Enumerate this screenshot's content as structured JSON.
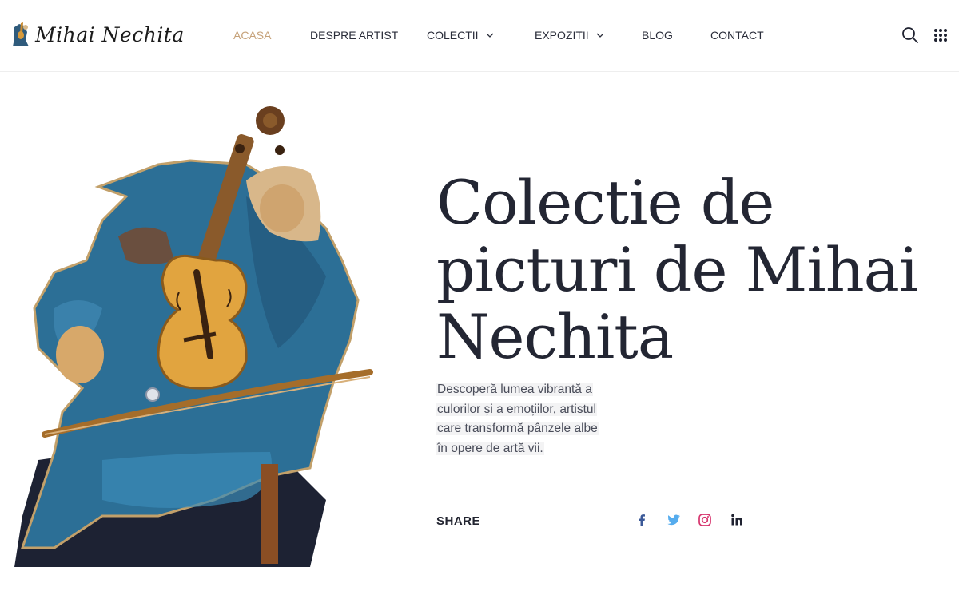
{
  "logo": {
    "text": "Mihai Nechita",
    "icon": "violinist-logo-icon"
  },
  "nav": [
    {
      "label": "ACASA",
      "active": true,
      "dropdown": false
    },
    {
      "label": "DESPRE ARTIST",
      "active": false,
      "dropdown": false
    },
    {
      "label": "COLECTII",
      "active": false,
      "dropdown": true
    },
    {
      "label": "EXPOZITII",
      "active": false,
      "dropdown": true
    },
    {
      "label": "BLOG",
      "active": false,
      "dropdown": false
    },
    {
      "label": "CONTACT",
      "active": false,
      "dropdown": false
    }
  ],
  "header_icons": [
    "search-icon",
    "grid-menu-icon"
  ],
  "hero": {
    "title_line1": "Colectie de",
    "title_line2": "picturi de Mihai",
    "title_line3": "Nechita",
    "desc_line1": "Descoperă lumea vibrantă a",
    "desc_line2": "culorilor și a emoțiilor, artistul",
    "desc_line3": "care transformă pânzele albe",
    "desc_line4": "în opere de artă vii."
  },
  "share": {
    "label": "SHARE",
    "networks": [
      {
        "name": "facebook-icon",
        "color": "#3b5998"
      },
      {
        "name": "twitter-icon",
        "color": "#55acee"
      },
      {
        "name": "instagram-icon",
        "color": "#d6336c"
      },
      {
        "name": "linkedin-icon",
        "color": "#1f2230"
      }
    ]
  },
  "colors": {
    "accent": "#c6a27a",
    "text": "#232633"
  }
}
